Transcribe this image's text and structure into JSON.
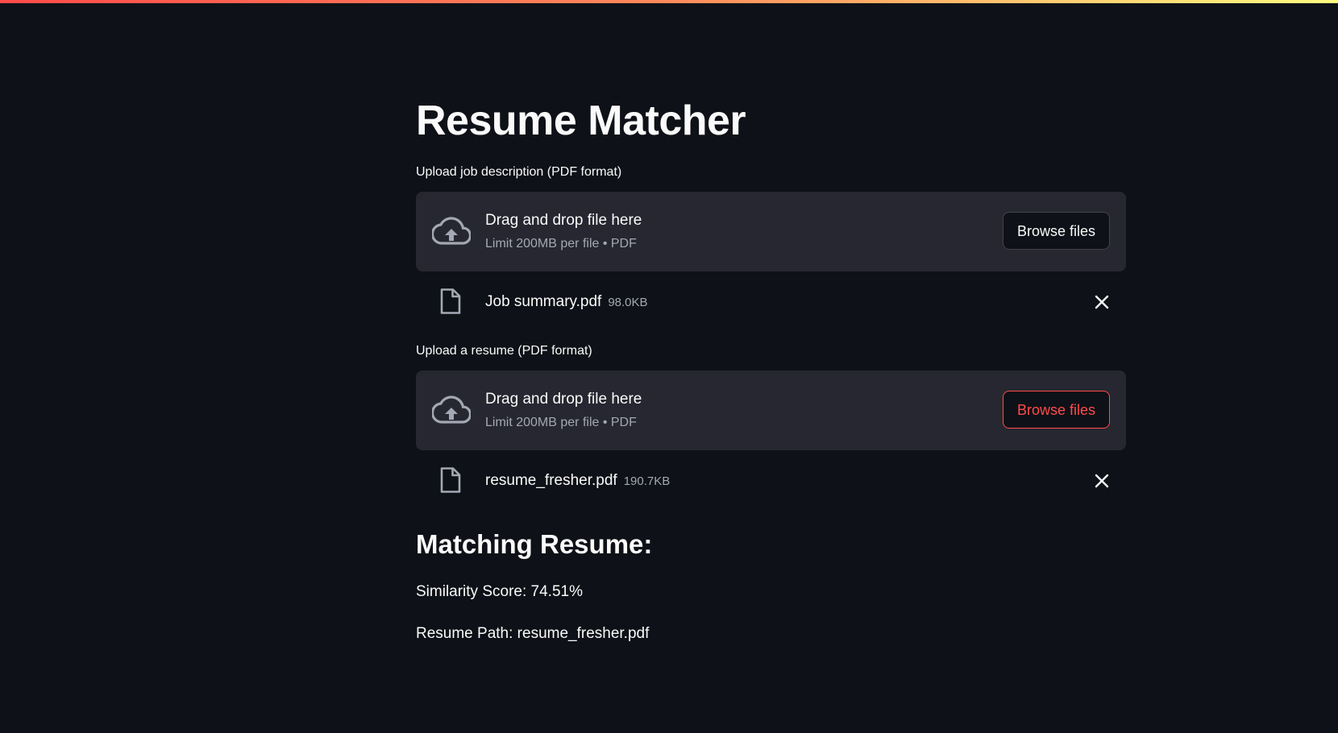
{
  "app": {
    "title": "Resume Matcher"
  },
  "uploaders": [
    {
      "label": "Upload job description (PDF format)",
      "dropzone_title": "Drag and drop file here",
      "dropzone_limit": "Limit 200MB per file • PDF",
      "browse_label": "Browse files",
      "file": {
        "name": "Job summary.pdf",
        "size": "98.0KB"
      }
    },
    {
      "label": "Upload a resume (PDF format)",
      "dropzone_title": "Drag and drop file here",
      "dropzone_limit": "Limit 200MB per file • PDF",
      "browse_label": "Browse files",
      "file": {
        "name": "resume_fresher.pdf",
        "size": "190.7KB"
      }
    }
  ],
  "result": {
    "heading": "Matching Resume:",
    "similarity": "Similarity Score: 74.51%",
    "path": "Resume Path: resume_fresher.pdf"
  },
  "icons": {
    "upload": "cloud-upload-icon",
    "file": "file-icon",
    "remove": "close-icon"
  },
  "colors": {
    "background": "#0e1117",
    "dropzone": "#262730",
    "accent": "#ff4b4b",
    "muted_text": "#a3a8b4"
  }
}
